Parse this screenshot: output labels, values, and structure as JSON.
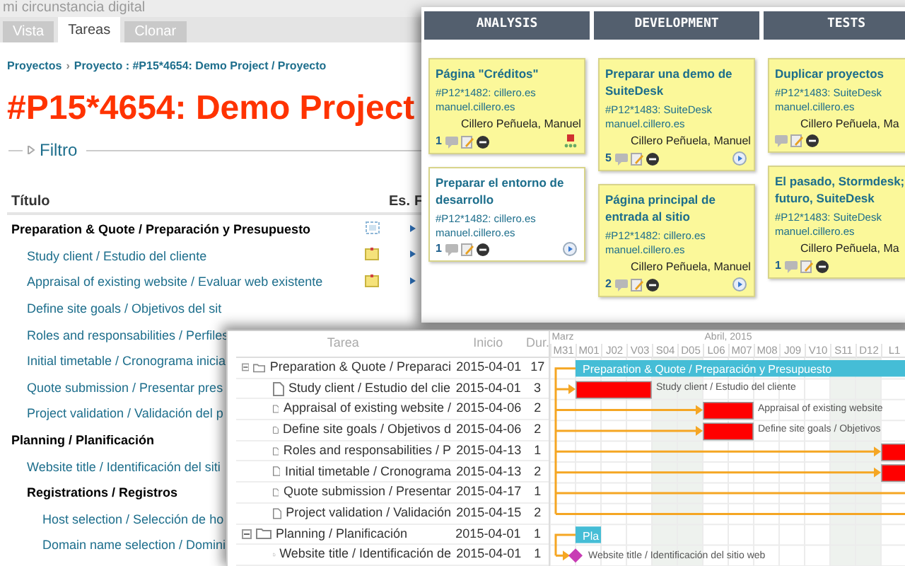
{
  "site_name": "mi circunstancia digital",
  "tabs": [
    {
      "label": "Vista",
      "selected": false
    },
    {
      "label": "Tareas",
      "selected": true
    },
    {
      "label": "Clonar",
      "selected": false
    }
  ],
  "breadcrumb": {
    "items": [
      "Proyectos",
      "Proyecto : #P15*4654: Demo Project / Proyecto"
    ],
    "separator": "›"
  },
  "title": "#P15*4654: Demo Project",
  "filter": {
    "label": "Filtro",
    "expanded": false
  },
  "task_list": {
    "columns": [
      "Título",
      "Es.",
      "F"
    ],
    "rows": [
      {
        "kind": "group",
        "title": "Preparation & Quote / Preparación y Presupuesto",
        "status": {
          "kind": "subtasks"
        },
        "children": [
          {
            "kind": "task",
            "title": "Study client / Estudio del cliente",
            "status": {
              "kind": "note"
            }
          },
          {
            "kind": "task",
            "title": "Appraisal of existing website / Evaluar web existente",
            "status": {
              "kind": "note"
            }
          },
          {
            "kind": "task",
            "title": "Define site goals / Objetivos del sit"
          },
          {
            "kind": "task",
            "title": "Roles and responsabilities / Perfiles"
          },
          {
            "kind": "task",
            "title": "Initial timetable / Cronograma inicia"
          },
          {
            "kind": "task",
            "title": "Quote submission / Presentar pres"
          },
          {
            "kind": "task",
            "title": "Project validation / Validación del p"
          }
        ]
      },
      {
        "kind": "group",
        "title": "Planning / Planificación",
        "children": [
          {
            "kind": "task",
            "title": "Website title / Identificación del siti"
          },
          {
            "kind": "group",
            "title": "Registrations / Registros",
            "children": [
              {
                "kind": "task",
                "title": "Host selection / Selección de ho"
              },
              {
                "kind": "task",
                "title": "Domain name selection / Domini"
              }
            ]
          }
        ]
      }
    ]
  },
  "kanban": {
    "columns": [
      {
        "title": "ANALYSIS",
        "cards": [
          {
            "title": "Página \"Créditos\"",
            "project": "#P12*1482: cillero.es",
            "site": "manuel.cillero.es",
            "owner": "Cillero Peñuela, Manuel",
            "count": "1",
            "color": "#fbf89a",
            "play": false,
            "alert": true
          },
          {
            "title": "Preparar el entorno de desarrollo",
            "project": "#P12*1482: cillero.es",
            "site": "manuel.cillero.es",
            "count": "1",
            "color": "#ffffff",
            "play": true,
            "alert": false
          }
        ]
      },
      {
        "title": "DEVELOPMENT",
        "cards": [
          {
            "title": "Preparar una demo de SuiteDesk",
            "project": "#P12*1483: SuiteDesk",
            "site": "manuel.cillero.es",
            "owner": "Cillero Peñuela, Manuel",
            "count": "5",
            "color": "#fbf89a",
            "play": true,
            "alert": false
          },
          {
            "title": "Página principal de entrada al sitio",
            "project": "#P12*1482: cillero.es",
            "site": "manuel.cillero.es",
            "owner": "Cillero Peñuela, Manuel",
            "count": "2",
            "color": "#fbf89a",
            "play": true,
            "alert": false
          }
        ]
      },
      {
        "title": "TESTS",
        "cards": [
          {
            "title": "Duplicar proyectos",
            "project": "#P12*1483: SuiteDesk",
            "site": "manuel.cillero.es",
            "owner": "Cillero Peñuela, Ma",
            "color": "#fbf89a",
            "play": false,
            "alert": false
          },
          {
            "title": "El pasado, Stormdesk;\nfuturo, SuiteDesk",
            "project": "#P12*1483: SuiteDesk",
            "site": "manuel.cillero.es",
            "owner": "Cillero Peñuela, Ma",
            "count": "1",
            "color": "#fbf89a",
            "play": false,
            "alert": false
          }
        ]
      }
    ]
  },
  "gantt": {
    "columns": [
      "Tarea",
      "Inicio",
      "Dur."
    ],
    "months": [
      {
        "label": "Marz"
      },
      {
        "label": "Abril, 2015"
      }
    ],
    "days": [
      {
        "label": "M31",
        "weekend": false
      },
      {
        "label": "M01",
        "weekend": false
      },
      {
        "label": "J02",
        "weekend": false
      },
      {
        "label": "V03",
        "weekend": false
      },
      {
        "label": "S04",
        "weekend": true
      },
      {
        "label": "D05",
        "weekend": true
      },
      {
        "label": "L06",
        "weekend": false
      },
      {
        "label": "M07",
        "weekend": false
      },
      {
        "label": "M08",
        "weekend": false
      },
      {
        "label": "J09",
        "weekend": false
      },
      {
        "label": "V10",
        "weekend": false
      },
      {
        "label": "S11",
        "weekend": true
      },
      {
        "label": "D12",
        "weekend": true
      },
      {
        "label": "L1",
        "weekend": false
      }
    ],
    "rows": [
      {
        "kind": "summary",
        "name": "Preparation & Quote / Preparaci",
        "start": "2015-04-01",
        "duration": "17",
        "expanded": true,
        "bar_label": "Preparation & Quote / Preparación y Presupuesto",
        "children": [
          {
            "kind": "task",
            "name": "Study client / Estudio del clie",
            "start": "2015-04-01",
            "duration": "3",
            "bar_label": "Study client / Estudio del cliente"
          },
          {
            "kind": "task",
            "name": "Appraisal of existing website /",
            "start": "2015-04-06",
            "duration": "2",
            "bar_label": "Appraisal of existing website"
          },
          {
            "kind": "task",
            "name": "Define site goals / Objetivos d",
            "start": "2015-04-06",
            "duration": "2",
            "bar_label": "Define site goals / Objetivos"
          },
          {
            "kind": "task",
            "name": "Roles and responsabilities / P",
            "start": "2015-04-13",
            "duration": "1"
          },
          {
            "kind": "task",
            "name": "Initial timetable / Cronograma",
            "start": "2015-04-13",
            "duration": "2"
          },
          {
            "kind": "task",
            "name": "Quote submission / Presentar",
            "start": "2015-04-17",
            "duration": "1"
          },
          {
            "kind": "task",
            "name": "Project validation / Validación",
            "start": "2015-04-15",
            "duration": "2"
          }
        ]
      },
      {
        "kind": "summary",
        "name": "Planning / Planificación",
        "start": "2015-04-01",
        "duration": "1",
        "expanded": true,
        "bar_label": "Pla",
        "children": [
          {
            "kind": "milestone",
            "name": "Website title / Identificación de",
            "start": "2015-04-01",
            "duration": "1",
            "bar_label": "Website title / Identificación del sitio web"
          }
        ]
      }
    ]
  }
}
